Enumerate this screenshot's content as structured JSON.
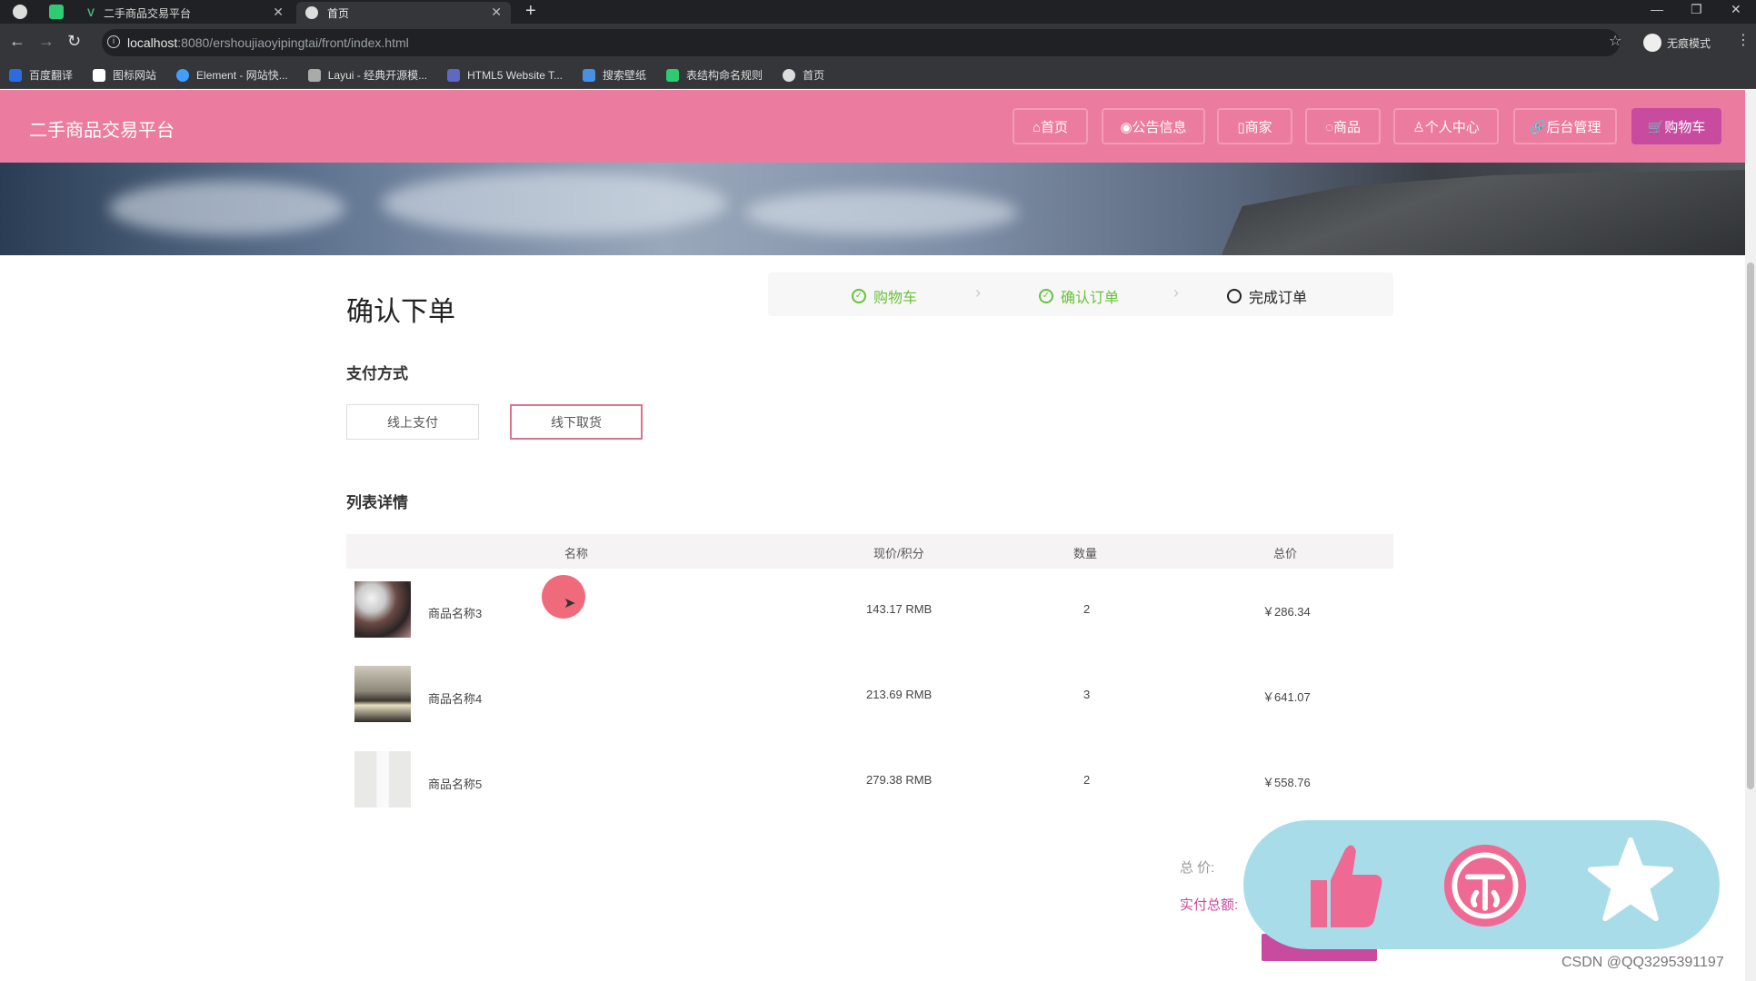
{
  "browser": {
    "tabs": [
      {
        "label": "二手商品交易平台"
      },
      {
        "label": "首页"
      }
    ],
    "url_host": "localhost",
    "url_rest": ":8080/ershoujiaoyipingtai/front/index.html",
    "profile_label": "无痕模式",
    "bookmarks": [
      {
        "label": "百度翻译",
        "color": "#2b6de0"
      },
      {
        "label": "图标网站",
        "color": "#fff"
      },
      {
        "label": "Element - 网站快...",
        "color": "#409eff"
      },
      {
        "label": "Layui - 经典开源模...",
        "color": "#aaa"
      },
      {
        "label": "HTML5 Website T...",
        "color": "#5c6bc0"
      },
      {
        "label": "搜索壁纸",
        "color": "#4a90e2"
      },
      {
        "label": "表结构命名规则",
        "color": "#2ecc71"
      },
      {
        "label": "首页",
        "color": "#ddd"
      }
    ]
  },
  "site": {
    "title": "二手商品交易平台",
    "nav": [
      {
        "label": "⌂首页"
      },
      {
        "label": "◉公告信息"
      },
      {
        "label": "▯商家"
      },
      {
        "label": "◌商品"
      },
      {
        "label": "♙个人中心"
      },
      {
        "label": "🔗后台管理"
      },
      {
        "label": "🛒购物车"
      }
    ]
  },
  "page": {
    "title": "确认下单",
    "steps": [
      {
        "label": "购物车",
        "status": "done"
      },
      {
        "label": "确认订单",
        "status": "done"
      },
      {
        "label": "完成订单",
        "status": "current"
      }
    ],
    "payment_label": "支付方式",
    "payment_options": [
      {
        "label": "线上支付",
        "selected": false
      },
      {
        "label": "线下取货",
        "selected": true
      }
    ],
    "list_label": "列表详情",
    "table_headers": {
      "name": "名称",
      "price": "现价/积分",
      "qty": "数量",
      "total": "总价"
    },
    "rows": [
      {
        "name": "商品名称3",
        "price": "143.17 RMB",
        "qty": "2",
        "total": "￥286.34"
      },
      {
        "name": "商品名称4",
        "price": "213.69 RMB",
        "qty": "3",
        "total": "￥641.07"
      },
      {
        "name": "商品名称5",
        "price": "279.38 RMB",
        "qty": "2",
        "total": "￥558.76"
      }
    ],
    "total_label": "总  价:",
    "paid_label": "实付总额:"
  },
  "overlay_icons": [
    "thumbs-up-icon",
    "coin-icon",
    "star-icon"
  ],
  "watermark": "CSDN @QQ3295391197",
  "colors": {
    "header": "#ec7ba0",
    "accent": "#c84b9f",
    "success": "#67c23a"
  }
}
